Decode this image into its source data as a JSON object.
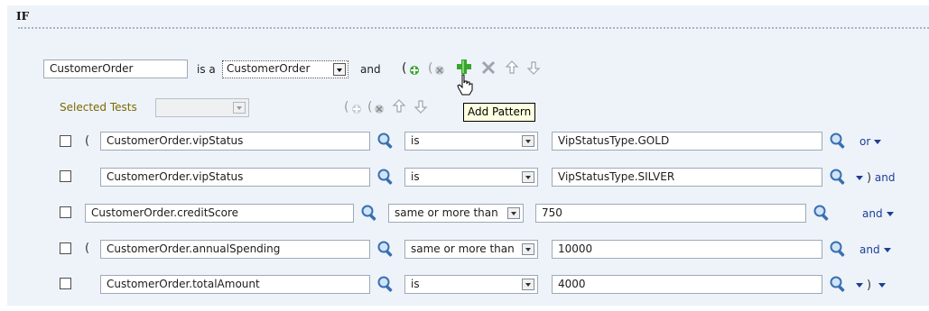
{
  "header": {
    "title": "IF"
  },
  "pattern": {
    "variable": "CustomerOrder",
    "is_a_label": "is a",
    "type_value": "CustomerOrder",
    "and_label": "and"
  },
  "toolbar_tooltip": "Add Pattern",
  "selected_tests": {
    "label": "Selected Tests",
    "value": ""
  },
  "colors": {
    "accent": "#1c3f91",
    "add_green": "#3aa52e",
    "tooltip_bg": "#ffffe1",
    "panel_bg": "#eef3fa"
  },
  "icons": [
    "add-parens-icon",
    "remove-parens-icon",
    "add-pattern-icon",
    "delete-icon",
    "move-up-icon",
    "move-down-icon",
    "search-icon",
    "hand-cursor-icon"
  ],
  "tests": [
    {
      "open_paren": "(",
      "left": "CustomerOrder.vipStatus",
      "operator": "is",
      "right": "VipStatusType.GOLD",
      "close_paren": "",
      "conj": "or"
    },
    {
      "open_paren": "",
      "left": "CustomerOrder.vipStatus",
      "operator": "is",
      "right": "VipStatusType.SILVER",
      "close_paren": ")",
      "conj": "and"
    },
    {
      "open_paren": "",
      "left": "CustomerOrder.creditScore",
      "operator": "same or more than",
      "right": "750",
      "close_paren": "",
      "conj": "and"
    },
    {
      "open_paren": "(",
      "left": "CustomerOrder.annualSpending",
      "operator": "same or more than",
      "right": "10000",
      "close_paren": "",
      "conj": "and"
    },
    {
      "open_paren": "",
      "left": "CustomerOrder.totalAmount",
      "operator": "is",
      "right": "4000",
      "close_paren": ")",
      "conj": ""
    }
  ]
}
